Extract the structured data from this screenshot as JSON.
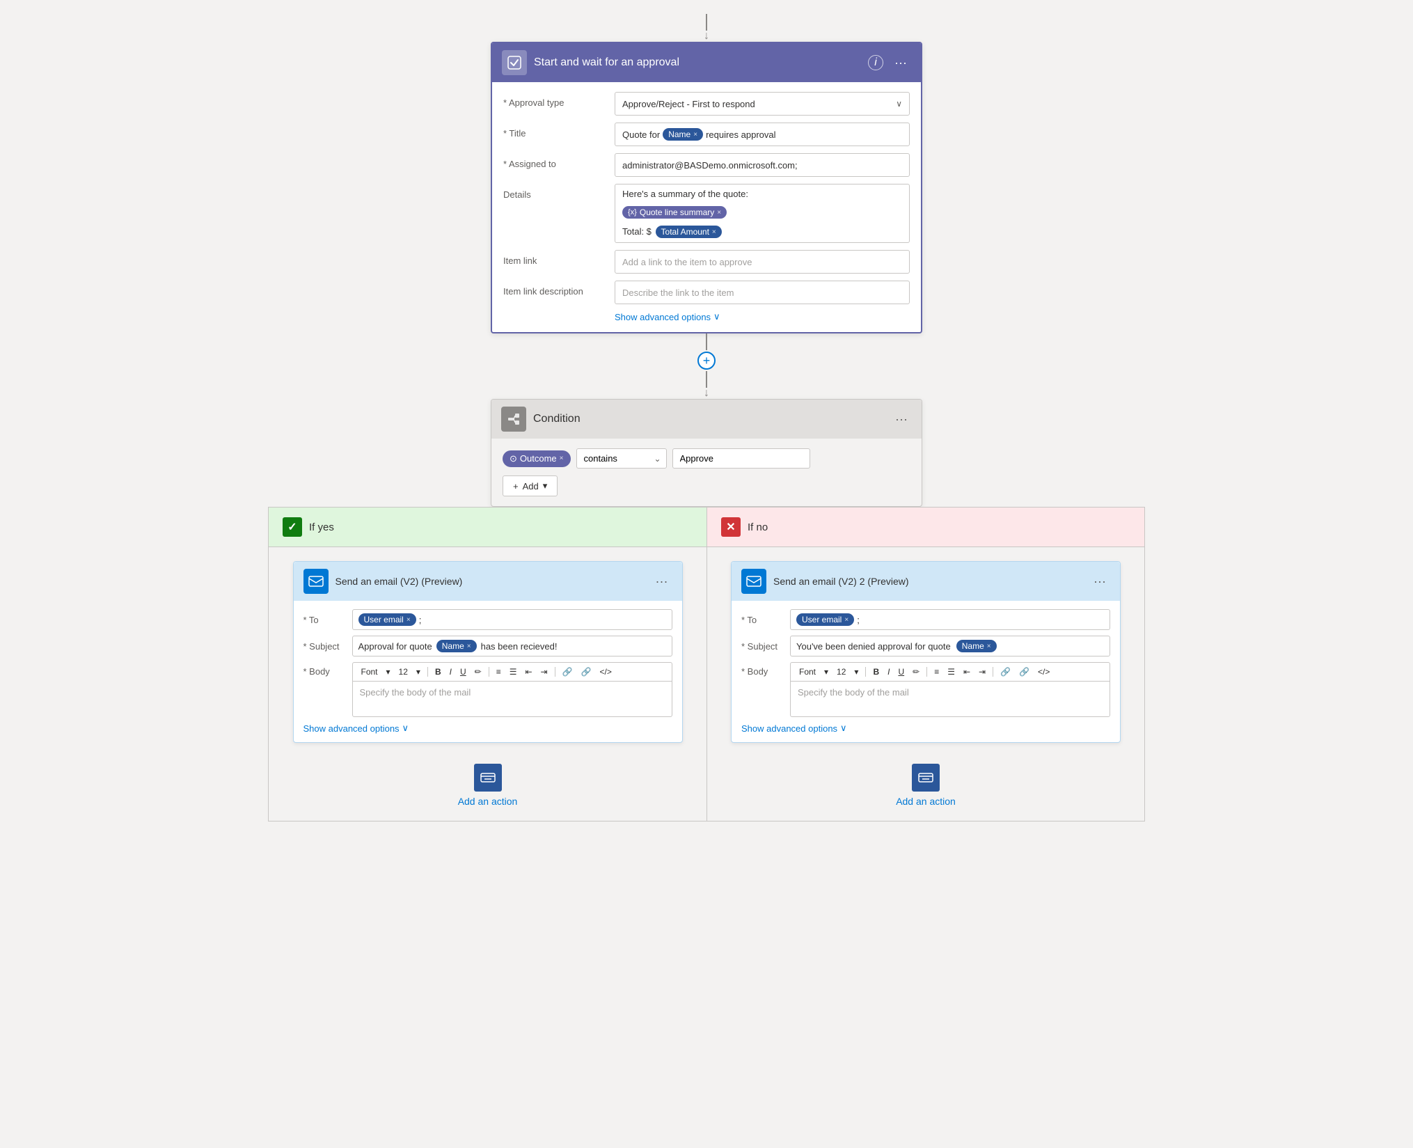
{
  "top": {
    "connector_arrow": "↓"
  },
  "approval": {
    "title": "Start and wait for an approval",
    "icon": "✓",
    "info_label": "i",
    "dots_label": "···",
    "fields": {
      "approval_type_label": "* Approval type",
      "approval_type_value": "Approve/Reject - First to respond",
      "title_label": "* Title",
      "title_prefix": "Quote for",
      "title_token": "Name",
      "title_suffix": "requires approval",
      "assigned_label": "* Assigned to",
      "assigned_value": "administrator@BASDemo.onmicrosoft.com;",
      "details_label": "Details",
      "details_line1": "Here's a summary of the quote:",
      "details_token1": "Quote line summary",
      "details_line2": "Total: $",
      "details_token2": "Total Amount",
      "item_link_label": "Item link",
      "item_link_placeholder": "Add a link to the item to approve",
      "item_link_desc_label": "Item link description",
      "item_link_desc_placeholder": "Describe the link to the item",
      "show_advanced": "Show advanced options"
    }
  },
  "middle_connector": {
    "plus": "+",
    "arrow": "↓"
  },
  "condition": {
    "title": "Condition",
    "dots_label": "···",
    "token": "Outcome",
    "operator": "contains",
    "value": "Approve",
    "add_btn": "+ Add",
    "add_dropdown": "▾"
  },
  "if_yes": {
    "label": "If yes",
    "email": {
      "title": "Send an email (V2) (Preview)",
      "dots_label": "···",
      "to_label": "* To",
      "to_token": "User email",
      "to_suffix": ";",
      "subject_label": "* Subject",
      "subject_prefix": "Approval for quote",
      "subject_token": "Name",
      "subject_suffix": "has been recieved!",
      "body_label": "* Body",
      "font_label": "Font",
      "font_size": "12",
      "body_placeholder": "Specify the body of the mail",
      "show_advanced": "Show advanced options"
    },
    "add_action": "Add an action"
  },
  "if_no": {
    "label": "If no",
    "email": {
      "title": "Send an email (V2) 2 (Preview)",
      "dots_label": "···",
      "to_label": "* To",
      "to_token": "User email",
      "to_suffix": ";",
      "subject_label": "* Subject",
      "subject_prefix": "You've been denied approval for quote",
      "subject_token": "Name",
      "body_label": "* Body",
      "font_label": "Font",
      "font_size": "12",
      "body_placeholder": "Specify the body of the mail",
      "show_advanced": "Show advanced options"
    },
    "add_action": "Add an action"
  },
  "toolbar_items": [
    "B",
    "I",
    "U"
  ],
  "toolbar_icons": [
    "✏️",
    "≡",
    "☰",
    "⇤",
    "⇥",
    "🔗",
    "⛔",
    "</>"
  ]
}
